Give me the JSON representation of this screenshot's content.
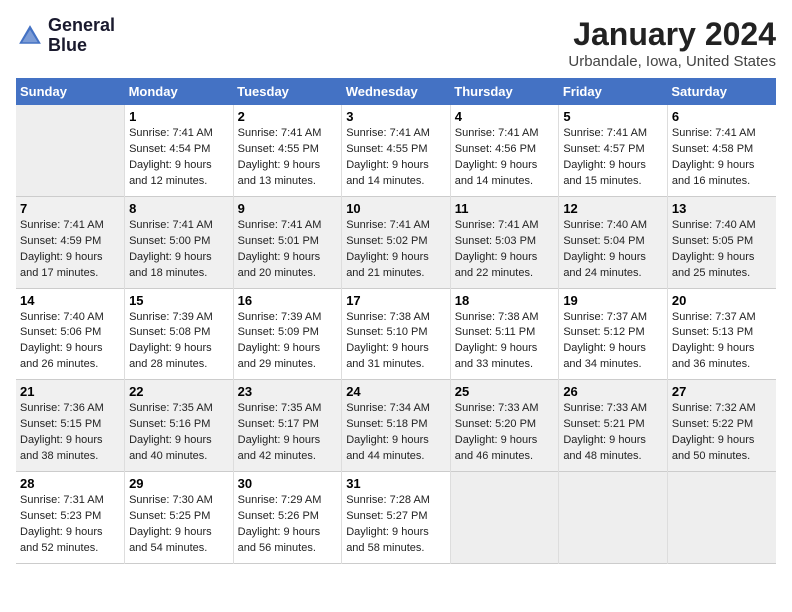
{
  "logo": {
    "line1": "General",
    "line2": "Blue"
  },
  "title": "January 2024",
  "subtitle": "Urbandale, Iowa, United States",
  "days_header": [
    "Sunday",
    "Monday",
    "Tuesday",
    "Wednesday",
    "Thursday",
    "Friday",
    "Saturday"
  ],
  "weeks": [
    [
      {
        "num": "",
        "sunrise": "",
        "sunset": "",
        "daylight": "",
        "empty": true
      },
      {
        "num": "1",
        "sunrise": "Sunrise: 7:41 AM",
        "sunset": "Sunset: 4:54 PM",
        "daylight": "Daylight: 9 hours and 12 minutes."
      },
      {
        "num": "2",
        "sunrise": "Sunrise: 7:41 AM",
        "sunset": "Sunset: 4:55 PM",
        "daylight": "Daylight: 9 hours and 13 minutes."
      },
      {
        "num": "3",
        "sunrise": "Sunrise: 7:41 AM",
        "sunset": "Sunset: 4:55 PM",
        "daylight": "Daylight: 9 hours and 14 minutes."
      },
      {
        "num": "4",
        "sunrise": "Sunrise: 7:41 AM",
        "sunset": "Sunset: 4:56 PM",
        "daylight": "Daylight: 9 hours and 14 minutes."
      },
      {
        "num": "5",
        "sunrise": "Sunrise: 7:41 AM",
        "sunset": "Sunset: 4:57 PM",
        "daylight": "Daylight: 9 hours and 15 minutes."
      },
      {
        "num": "6",
        "sunrise": "Sunrise: 7:41 AM",
        "sunset": "Sunset: 4:58 PM",
        "daylight": "Daylight: 9 hours and 16 minutes."
      }
    ],
    [
      {
        "num": "7",
        "sunrise": "Sunrise: 7:41 AM",
        "sunset": "Sunset: 4:59 PM",
        "daylight": "Daylight: 9 hours and 17 minutes."
      },
      {
        "num": "8",
        "sunrise": "Sunrise: 7:41 AM",
        "sunset": "Sunset: 5:00 PM",
        "daylight": "Daylight: 9 hours and 18 minutes."
      },
      {
        "num": "9",
        "sunrise": "Sunrise: 7:41 AM",
        "sunset": "Sunset: 5:01 PM",
        "daylight": "Daylight: 9 hours and 20 minutes."
      },
      {
        "num": "10",
        "sunrise": "Sunrise: 7:41 AM",
        "sunset": "Sunset: 5:02 PM",
        "daylight": "Daylight: 9 hours and 21 minutes."
      },
      {
        "num": "11",
        "sunrise": "Sunrise: 7:41 AM",
        "sunset": "Sunset: 5:03 PM",
        "daylight": "Daylight: 9 hours and 22 minutes."
      },
      {
        "num": "12",
        "sunrise": "Sunrise: 7:40 AM",
        "sunset": "Sunset: 5:04 PM",
        "daylight": "Daylight: 9 hours and 24 minutes."
      },
      {
        "num": "13",
        "sunrise": "Sunrise: 7:40 AM",
        "sunset": "Sunset: 5:05 PM",
        "daylight": "Daylight: 9 hours and 25 minutes."
      }
    ],
    [
      {
        "num": "14",
        "sunrise": "Sunrise: 7:40 AM",
        "sunset": "Sunset: 5:06 PM",
        "daylight": "Daylight: 9 hours and 26 minutes."
      },
      {
        "num": "15",
        "sunrise": "Sunrise: 7:39 AM",
        "sunset": "Sunset: 5:08 PM",
        "daylight": "Daylight: 9 hours and 28 minutes."
      },
      {
        "num": "16",
        "sunrise": "Sunrise: 7:39 AM",
        "sunset": "Sunset: 5:09 PM",
        "daylight": "Daylight: 9 hours and 29 minutes."
      },
      {
        "num": "17",
        "sunrise": "Sunrise: 7:38 AM",
        "sunset": "Sunset: 5:10 PM",
        "daylight": "Daylight: 9 hours and 31 minutes."
      },
      {
        "num": "18",
        "sunrise": "Sunrise: 7:38 AM",
        "sunset": "Sunset: 5:11 PM",
        "daylight": "Daylight: 9 hours and 33 minutes."
      },
      {
        "num": "19",
        "sunrise": "Sunrise: 7:37 AM",
        "sunset": "Sunset: 5:12 PM",
        "daylight": "Daylight: 9 hours and 34 minutes."
      },
      {
        "num": "20",
        "sunrise": "Sunrise: 7:37 AM",
        "sunset": "Sunset: 5:13 PM",
        "daylight": "Daylight: 9 hours and 36 minutes."
      }
    ],
    [
      {
        "num": "21",
        "sunrise": "Sunrise: 7:36 AM",
        "sunset": "Sunset: 5:15 PM",
        "daylight": "Daylight: 9 hours and 38 minutes."
      },
      {
        "num": "22",
        "sunrise": "Sunrise: 7:35 AM",
        "sunset": "Sunset: 5:16 PM",
        "daylight": "Daylight: 9 hours and 40 minutes."
      },
      {
        "num": "23",
        "sunrise": "Sunrise: 7:35 AM",
        "sunset": "Sunset: 5:17 PM",
        "daylight": "Daylight: 9 hours and 42 minutes."
      },
      {
        "num": "24",
        "sunrise": "Sunrise: 7:34 AM",
        "sunset": "Sunset: 5:18 PM",
        "daylight": "Daylight: 9 hours and 44 minutes."
      },
      {
        "num": "25",
        "sunrise": "Sunrise: 7:33 AM",
        "sunset": "Sunset: 5:20 PM",
        "daylight": "Daylight: 9 hours and 46 minutes."
      },
      {
        "num": "26",
        "sunrise": "Sunrise: 7:33 AM",
        "sunset": "Sunset: 5:21 PM",
        "daylight": "Daylight: 9 hours and 48 minutes."
      },
      {
        "num": "27",
        "sunrise": "Sunrise: 7:32 AM",
        "sunset": "Sunset: 5:22 PM",
        "daylight": "Daylight: 9 hours and 50 minutes."
      }
    ],
    [
      {
        "num": "28",
        "sunrise": "Sunrise: 7:31 AM",
        "sunset": "Sunset: 5:23 PM",
        "daylight": "Daylight: 9 hours and 52 minutes."
      },
      {
        "num": "29",
        "sunrise": "Sunrise: 7:30 AM",
        "sunset": "Sunset: 5:25 PM",
        "daylight": "Daylight: 9 hours and 54 minutes."
      },
      {
        "num": "30",
        "sunrise": "Sunrise: 7:29 AM",
        "sunset": "Sunset: 5:26 PM",
        "daylight": "Daylight: 9 hours and 56 minutes."
      },
      {
        "num": "31",
        "sunrise": "Sunrise: 7:28 AM",
        "sunset": "Sunset: 5:27 PM",
        "daylight": "Daylight: 9 hours and 58 minutes."
      },
      {
        "num": "",
        "sunrise": "",
        "sunset": "",
        "daylight": "",
        "empty": true
      },
      {
        "num": "",
        "sunrise": "",
        "sunset": "",
        "daylight": "",
        "empty": true
      },
      {
        "num": "",
        "sunrise": "",
        "sunset": "",
        "daylight": "",
        "empty": true
      }
    ]
  ]
}
